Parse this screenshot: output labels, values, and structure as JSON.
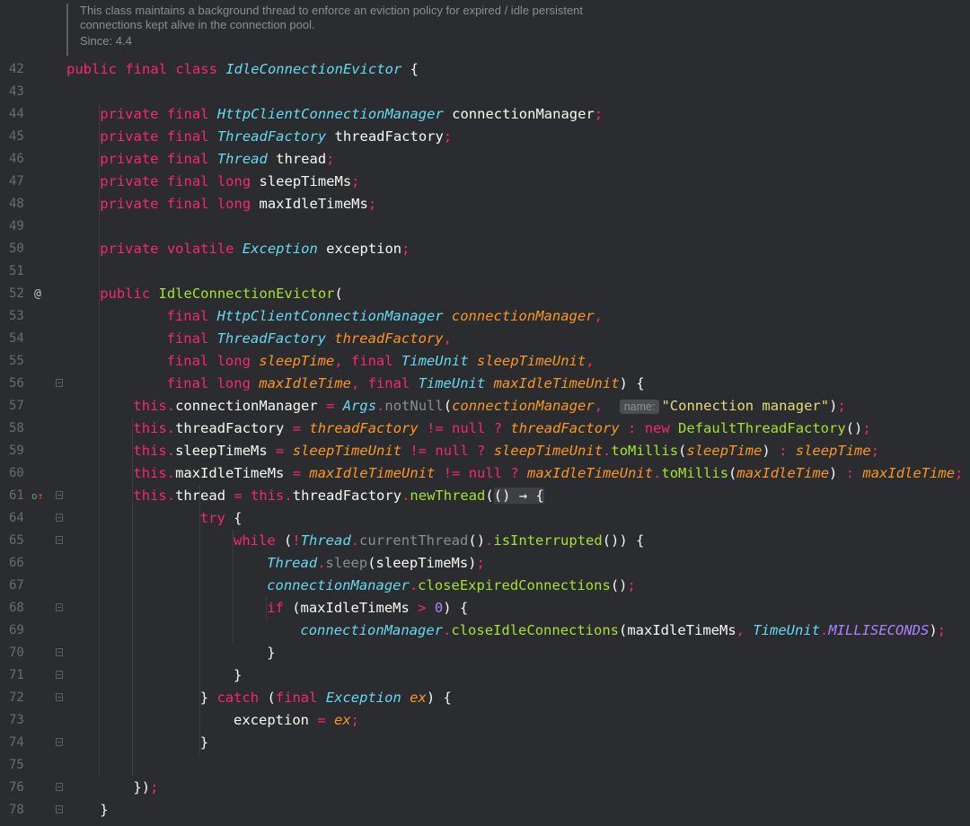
{
  "doc": {
    "line1": "This class maintains a background thread to enforce an eviction policy for expired / idle persistent",
    "line2": "connections kept alive in the connection pool.",
    "since": "Since: 4.4"
  },
  "lines": [
    {
      "n": "42",
      "t": [
        [
          "kw",
          "public final class "
        ],
        [
          "ty",
          "IdleConnectionEvictor"
        ],
        [
          "",
          "{"
        ]
      ]
    },
    {
      "n": "43",
      "t": []
    },
    {
      "n": "44",
      "i": 4,
      "t": [
        [
          "kw",
          "private final "
        ],
        [
          "ty",
          "HttpClientConnectionManager "
        ],
        [
          "",
          "connectionManager"
        ],
        [
          "kw",
          ";"
        ]
      ]
    },
    {
      "n": "45",
      "i": 4,
      "t": [
        [
          "kw",
          "private final "
        ],
        [
          "ty",
          "ThreadFactory "
        ],
        [
          "",
          "threadFactory"
        ],
        [
          "kw",
          ";"
        ]
      ]
    },
    {
      "n": "46",
      "i": 4,
      "t": [
        [
          "kw",
          "private final "
        ],
        [
          "ty",
          "Thread "
        ],
        [
          "",
          "thread"
        ],
        [
          "kw",
          ";"
        ]
      ]
    },
    {
      "n": "47",
      "i": 4,
      "t": [
        [
          "kw",
          "private final long "
        ],
        [
          "",
          "sleepTimeMs"
        ],
        [
          "kw",
          ";"
        ]
      ]
    },
    {
      "n": "48",
      "i": 4,
      "t": [
        [
          "kw",
          "private final long "
        ],
        [
          "",
          "maxIdleTimeMs"
        ],
        [
          "kw",
          ";"
        ]
      ]
    },
    {
      "n": "49",
      "t": []
    },
    {
      "n": "50",
      "i": 4,
      "t": [
        [
          "kw",
          "private volatile "
        ],
        [
          "ty",
          "Exception "
        ],
        [
          "",
          "exception"
        ],
        [
          "kw",
          ";"
        ]
      ]
    },
    {
      "n": "51",
      "t": []
    },
    {
      "n": "52",
      "m": "at",
      "i": 4,
      "t": [
        [
          "kw",
          "public "
        ],
        [
          "fn",
          "IdleConnectionEvictor"
        ],
        [
          "",
          "("
        ]
      ]
    },
    {
      "n": "53",
      "i": 12,
      "t": [
        [
          "kw",
          "final "
        ],
        [
          "ty",
          "HttpClientConnectionManager "
        ],
        [
          "pr",
          "connectionManager"
        ],
        [
          "kw",
          ","
        ]
      ]
    },
    {
      "n": "54",
      "i": 12,
      "t": [
        [
          "kw",
          "final "
        ],
        [
          "ty",
          "ThreadFactory "
        ],
        [
          "pr",
          "threadFactory"
        ],
        [
          "kw",
          ","
        ]
      ]
    },
    {
      "n": "55",
      "i": 12,
      "t": [
        [
          "kw",
          "final long "
        ],
        [
          "pr",
          "sleepTime"
        ],
        [
          "kw",
          ", final "
        ],
        [
          "ty",
          "TimeUnit "
        ],
        [
          "pr",
          "sleepTimeUnit"
        ],
        [
          "kw",
          ","
        ]
      ]
    },
    {
      "n": "56",
      "f": 1,
      "i": 12,
      "t": [
        [
          "kw",
          "final long "
        ],
        [
          "pr",
          "maxIdleTime"
        ],
        [
          "kw",
          ", final "
        ],
        [
          "ty",
          "TimeUnit "
        ],
        [
          "pr",
          "maxIdleTimeUnit"
        ],
        [
          "",
          ") {"
        ]
      ]
    },
    {
      "n": "57",
      "i": 8,
      "t": [
        [
          "kw",
          "this"
        ],
        [
          "kw",
          "."
        ],
        [
          "",
          "connectionManager "
        ],
        [
          "op",
          "= "
        ],
        [
          "ty",
          "Args"
        ],
        [
          "kw",
          "."
        ],
        [
          "dim",
          "notNull"
        ],
        [
          "",
          "("
        ],
        [
          "pr",
          "connectionManager"
        ],
        [
          "kw",
          ",  "
        ],
        [
          "hint",
          "name:"
        ],
        [
          "st",
          "\"Connection manager\""
        ],
        [
          "",
          ")"
        ],
        [
          "kw",
          ";"
        ]
      ]
    },
    {
      "n": "58",
      "i": 8,
      "t": [
        [
          "kw",
          "this"
        ],
        [
          "kw",
          "."
        ],
        [
          "",
          "threadFactory "
        ],
        [
          "op",
          "= "
        ],
        [
          "pr",
          "threadFactory "
        ],
        [
          "op",
          "!= "
        ],
        [
          "kw",
          "null "
        ],
        [
          "op",
          "? "
        ],
        [
          "pr",
          "threadFactory "
        ],
        [
          "op",
          ": "
        ],
        [
          "kw",
          "new "
        ],
        [
          "fn",
          "DefaultThreadFactory"
        ],
        [
          "",
          "()"
        ],
        [
          "kw",
          ";"
        ]
      ]
    },
    {
      "n": "59",
      "i": 8,
      "t": [
        [
          "kw",
          "this"
        ],
        [
          "kw",
          "."
        ],
        [
          "",
          "sleepTimeMs "
        ],
        [
          "op",
          "= "
        ],
        [
          "pr",
          "sleepTimeUnit "
        ],
        [
          "op",
          "!= "
        ],
        [
          "kw",
          "null "
        ],
        [
          "op",
          "? "
        ],
        [
          "pr",
          "sleepTimeUnit"
        ],
        [
          "kw",
          "."
        ],
        [
          "fn",
          "toMillis"
        ],
        [
          "",
          "("
        ],
        [
          "pr",
          "sleepTime"
        ],
        [
          "",
          ") "
        ],
        [
          "op",
          ": "
        ],
        [
          "pr",
          "sleepTime"
        ],
        [
          "kw",
          ";"
        ]
      ]
    },
    {
      "n": "60",
      "i": 8,
      "t": [
        [
          "kw",
          "this"
        ],
        [
          "kw",
          "."
        ],
        [
          "",
          "maxIdleTimeMs "
        ],
        [
          "op",
          "= "
        ],
        [
          "pr",
          "maxIdleTimeUnit "
        ],
        [
          "op",
          "!= "
        ],
        [
          "kw",
          "null "
        ],
        [
          "op",
          "? "
        ],
        [
          "pr",
          "maxIdleTimeUnit"
        ],
        [
          "kw",
          "."
        ],
        [
          "fn",
          "toMillis"
        ],
        [
          "",
          "("
        ],
        [
          "pr",
          "maxIdleTime"
        ],
        [
          "",
          ") "
        ],
        [
          "op",
          ": "
        ],
        [
          "pr",
          "maxIdleTime"
        ],
        [
          "kw",
          ";"
        ]
      ]
    },
    {
      "n": "61",
      "m": "ov",
      "f": 1,
      "i": 8,
      "t": [
        [
          "kw",
          "this"
        ],
        [
          "kw",
          "."
        ],
        [
          "",
          "thread "
        ],
        [
          "op",
          "= "
        ],
        [
          "kw",
          "this"
        ],
        [
          "kw",
          "."
        ],
        [
          "",
          "threadFactory"
        ],
        [
          "kw",
          "."
        ],
        [
          "fn",
          "newThread"
        ],
        [
          "",
          "("
        ],
        [
          "lam",
          "() → {"
        ]
      ]
    },
    {
      "n": "64",
      "f": 1,
      "i": 16,
      "t": [
        [
          "kw",
          "try "
        ],
        [
          "",
          "{"
        ]
      ]
    },
    {
      "n": "65",
      "f": 1,
      "i": 20,
      "t": [
        [
          "kw",
          "while "
        ],
        [
          "",
          "("
        ],
        [
          "op",
          "!"
        ],
        [
          "ty",
          "Thread"
        ],
        [
          "kw",
          "."
        ],
        [
          "dim",
          "currentThread"
        ],
        [
          "",
          "()"
        ],
        [
          "kw",
          "."
        ],
        [
          "fn",
          "isInterrupted"
        ],
        [
          "",
          "()) {"
        ]
      ]
    },
    {
      "n": "66",
      "i": 24,
      "t": [
        [
          "ty",
          "Thread"
        ],
        [
          "kw",
          "."
        ],
        [
          "dim",
          "sleep"
        ],
        [
          "",
          "(sleepTimeMs)"
        ],
        [
          "kw",
          ";"
        ]
      ]
    },
    {
      "n": "67",
      "i": 24,
      "t": [
        [
          "ty",
          "connectionManager"
        ],
        [
          "kw",
          "."
        ],
        [
          "fn",
          "closeExpiredConnections"
        ],
        [
          "",
          "()"
        ],
        [
          "kw",
          ";"
        ]
      ]
    },
    {
      "n": "68",
      "f": 1,
      "i": 24,
      "t": [
        [
          "kw",
          "if "
        ],
        [
          "",
          "(maxIdleTimeMs "
        ],
        [
          "op",
          "> "
        ],
        [
          "nu",
          "0"
        ],
        [
          "",
          ") {"
        ]
      ]
    },
    {
      "n": "69",
      "i": 28,
      "t": [
        [
          "ty",
          "connectionManager"
        ],
        [
          "kw",
          "."
        ],
        [
          "fn",
          "closeIdleConnections"
        ],
        [
          "",
          "(maxIdleTimeMs"
        ],
        [
          "kw",
          ", "
        ],
        [
          "ty",
          "TimeUnit"
        ],
        [
          "kw",
          "."
        ],
        [
          "cn",
          "MILLISECONDS"
        ],
        [
          "",
          ")"
        ],
        [
          "kw",
          ";"
        ]
      ]
    },
    {
      "n": "70",
      "f": 1,
      "i": 24,
      "t": [
        [
          "",
          "}"
        ]
      ]
    },
    {
      "n": "71",
      "f": 1,
      "i": 20,
      "t": [
        [
          "",
          "}"
        ]
      ]
    },
    {
      "n": "72",
      "f": 1,
      "i": 16,
      "t": [
        [
          "",
          "} "
        ],
        [
          "kw",
          "catch "
        ],
        [
          "",
          "("
        ],
        [
          "kw",
          "final "
        ],
        [
          "ty",
          "Exception "
        ],
        [
          "pr",
          "ex"
        ],
        [
          "",
          ") {"
        ]
      ]
    },
    {
      "n": "73",
      "i": 20,
      "t": [
        [
          "",
          "exception "
        ],
        [
          "op",
          "= "
        ],
        [
          "pr",
          "ex"
        ],
        [
          "kw",
          ";"
        ]
      ]
    },
    {
      "n": "74",
      "f": 1,
      "i": 16,
      "t": [
        [
          "",
          "}"
        ]
      ]
    },
    {
      "n": "75",
      "t": []
    },
    {
      "n": "76",
      "f": 1,
      "i": 8,
      "t": [
        [
          "",
          "})"
        ],
        [
          "kw",
          ";"
        ]
      ]
    },
    {
      "n": "78",
      "f": 1,
      "i": 4,
      "t": [
        [
          "",
          "}"
        ]
      ]
    }
  ]
}
